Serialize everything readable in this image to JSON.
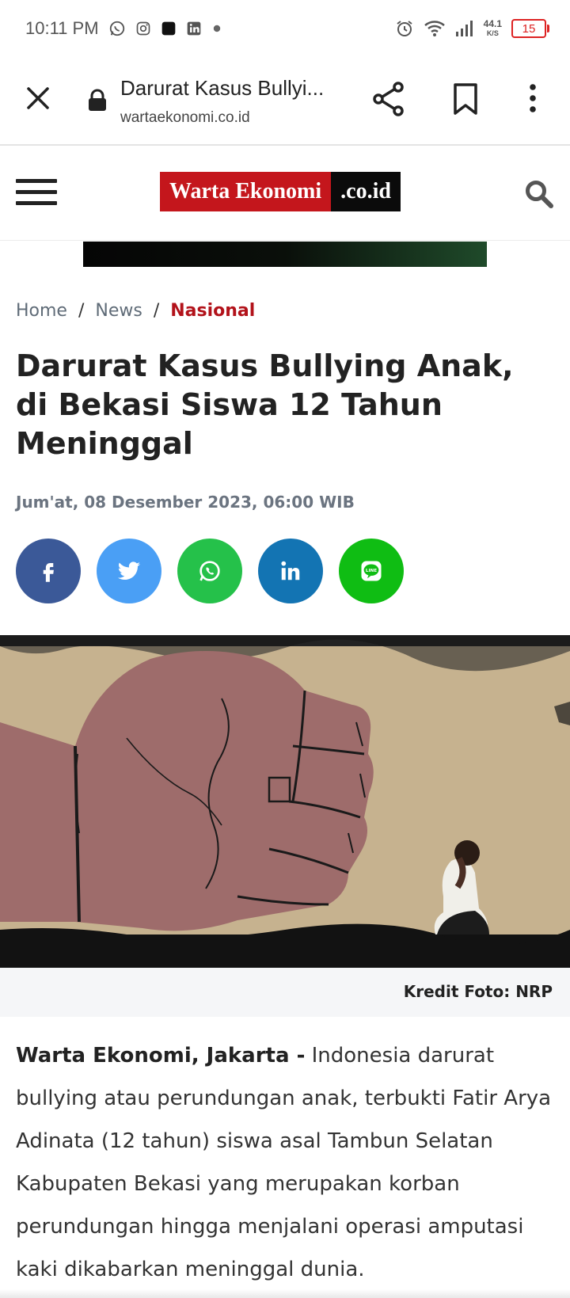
{
  "status_bar": {
    "time": "10:11 PM",
    "network_speed_value": "44.1",
    "network_speed_unit": "K/S",
    "battery": "15",
    "colors": {
      "battery": "#dd2222"
    }
  },
  "browser": {
    "page_title": "Darurat Kasus Bullyi...",
    "domain": "wartaekonomi.co.id"
  },
  "site": {
    "logo_primary": "Warta Ekonomi",
    "logo_suffix": ".co.id",
    "colors": {
      "brand_red": "#c4161c",
      "accent_text": "#b2121a"
    }
  },
  "breadcrumb": {
    "items": [
      "Home",
      "News",
      "Nasional"
    ],
    "separator": "/"
  },
  "article": {
    "headline": "Darurat Kasus Bullying Anak, di Bekasi Siswa 12 Tahun Meninggal",
    "date": "Jum'at, 08 Desember 2023, 06:00 WIB",
    "photo_credit": "Kredit Foto: NRP",
    "lead_label": "Warta Ekonomi, Jakarta -",
    "body_text": "Indonesia darurat bullying atau perundungan anak, terbukti Fatir Arya Adinata (12 tahun) siswa asal Tambun Selatan Kabupaten Bekasi yang merupakan korban perundungan hingga menjalani operasi amputasi kaki dikabarkan meninggal dunia."
  },
  "share_buttons": [
    {
      "name": "facebook",
      "icon": "facebook-icon",
      "color": "#3b5998"
    },
    {
      "name": "twitter",
      "icon": "twitter-icon",
      "color": "#4a9ff5"
    },
    {
      "name": "whatsapp",
      "icon": "whatsapp-icon",
      "color": "#25c14a"
    },
    {
      "name": "linkedin",
      "icon": "linkedin-icon",
      "color": "#1374b3"
    },
    {
      "name": "line",
      "icon": "line-icon",
      "color": "#0fbd13"
    }
  ]
}
